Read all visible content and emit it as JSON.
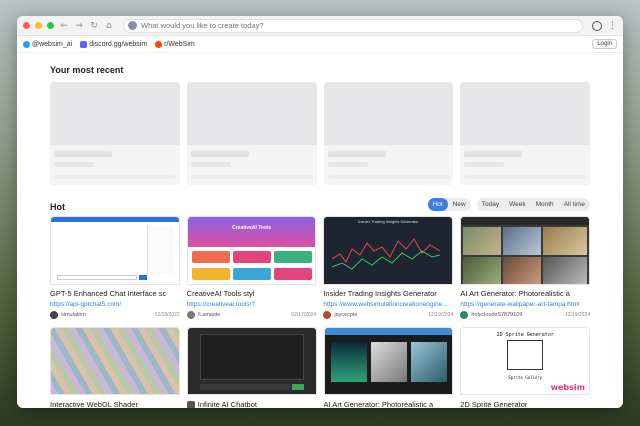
{
  "browser": {
    "search_placeholder": "What would you like to create today?",
    "traffic_lights": [
      "#ff5f57",
      "#febc2e",
      "#28c840"
    ]
  },
  "linkbar": {
    "items": [
      {
        "label": "@websim_ai",
        "icon": "twitter-icon",
        "color": "#1da1f2"
      },
      {
        "label": "discord.gg/websim",
        "icon": "discord-icon",
        "color": "#5865f2"
      },
      {
        "label": "r/WebSim",
        "icon": "reddit-icon",
        "color": "#ff4500"
      }
    ],
    "login_label": "Login"
  },
  "recent": {
    "title": "Your most recent",
    "placeholder_count": 4
  },
  "hot": {
    "title": "Hot",
    "sort_tabs": [
      {
        "label": "Hot",
        "active": true
      },
      {
        "label": "New",
        "active": false
      }
    ],
    "time_tabs": [
      "Today",
      "Week",
      "Month",
      "All time"
    ],
    "cards": [
      {
        "title": "GPT-5 Enhanced Chat Interface sc",
        "url": "https://api-gptchat5.com/",
        "user": "simulation",
        "date": "12/19/2023",
        "avatar_color": "#444"
      },
      {
        "title": "CreativeAI Tools styl",
        "url": "https://creativeai.tools/?",
        "user": "/Lamaste",
        "date": "02/17/2024",
        "avatar_color": "#7a7a7a"
      },
      {
        "title": "Insider Trading Insights Generator",
        "url": "https://www.websimulationcreationengine.com/insider-trading",
        "user": "jaycecpie",
        "date": "12/19/2024",
        "avatar_color": "#b24d2a"
      },
      {
        "title": "AI Art Generator: Photorealistic a",
        "url": "https://generate-wallpaper-art-tampa.html",
        "user": "holycloudsS7879109",
        "date": "12/19/2024",
        "avatar_color": "#2a8a6a"
      }
    ],
    "cards_row2": [
      {
        "title": "Interactive WebGL Shader",
        "icon": ""
      },
      {
        "title": "Infinite AI Chatbot",
        "icon": "robot-icon"
      },
      {
        "title": "AI Art Generator: Photorealistic a",
        "icon": ""
      },
      {
        "title": "2D Sprite Generator",
        "icon": ""
      }
    ],
    "creativeai_thumb_title": "CreativeAI Tools",
    "insider_thumb_title": "Insider Trading Insights Generator",
    "sprite_thumb_title": "2D Sprite Generator",
    "sprite_gallery_label": "Sprite Gallery",
    "watermark": "websim"
  }
}
